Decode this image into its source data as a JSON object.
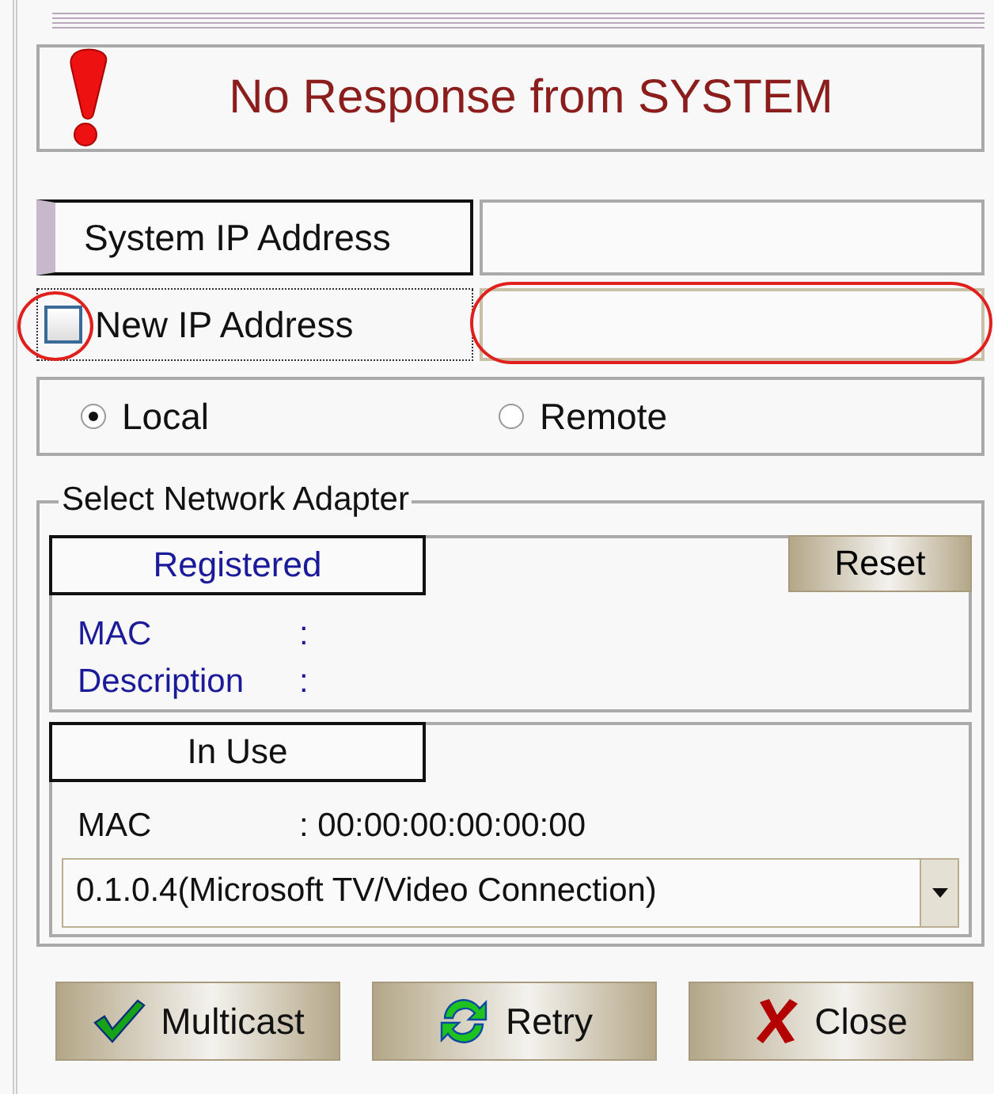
{
  "header": {
    "title": "No Response from SYSTEM"
  },
  "system_ip": {
    "label": "System IP Address"
  },
  "new_ip": {
    "label": "New IP Address",
    "checked": false,
    "highlighted": true,
    "field_highlighted": true
  },
  "mode": [
    {
      "label": "Local",
      "selected": true
    },
    {
      "label": "Remote",
      "selected": false
    }
  ],
  "adapter": {
    "legend": "Select Network Adapter",
    "registered": {
      "tab": "Registered",
      "reset": "Reset",
      "rows": [
        {
          "label": "MAC",
          "sep": ":"
        },
        {
          "label": "Description",
          "sep": ":"
        }
      ]
    },
    "in_use": {
      "tab": "In Use",
      "mac_label": "MAC",
      "mac_value": ": 00:00:00:00:00:00",
      "adapter": "0.1.0.4(Microsoft TV/Video Connection)"
    }
  },
  "buttons": [
    {
      "kind": "check",
      "label": "Multicast"
    },
    {
      "kind": "refresh",
      "label": "Retry"
    },
    {
      "kind": "cross",
      "label": "Close"
    }
  ]
}
